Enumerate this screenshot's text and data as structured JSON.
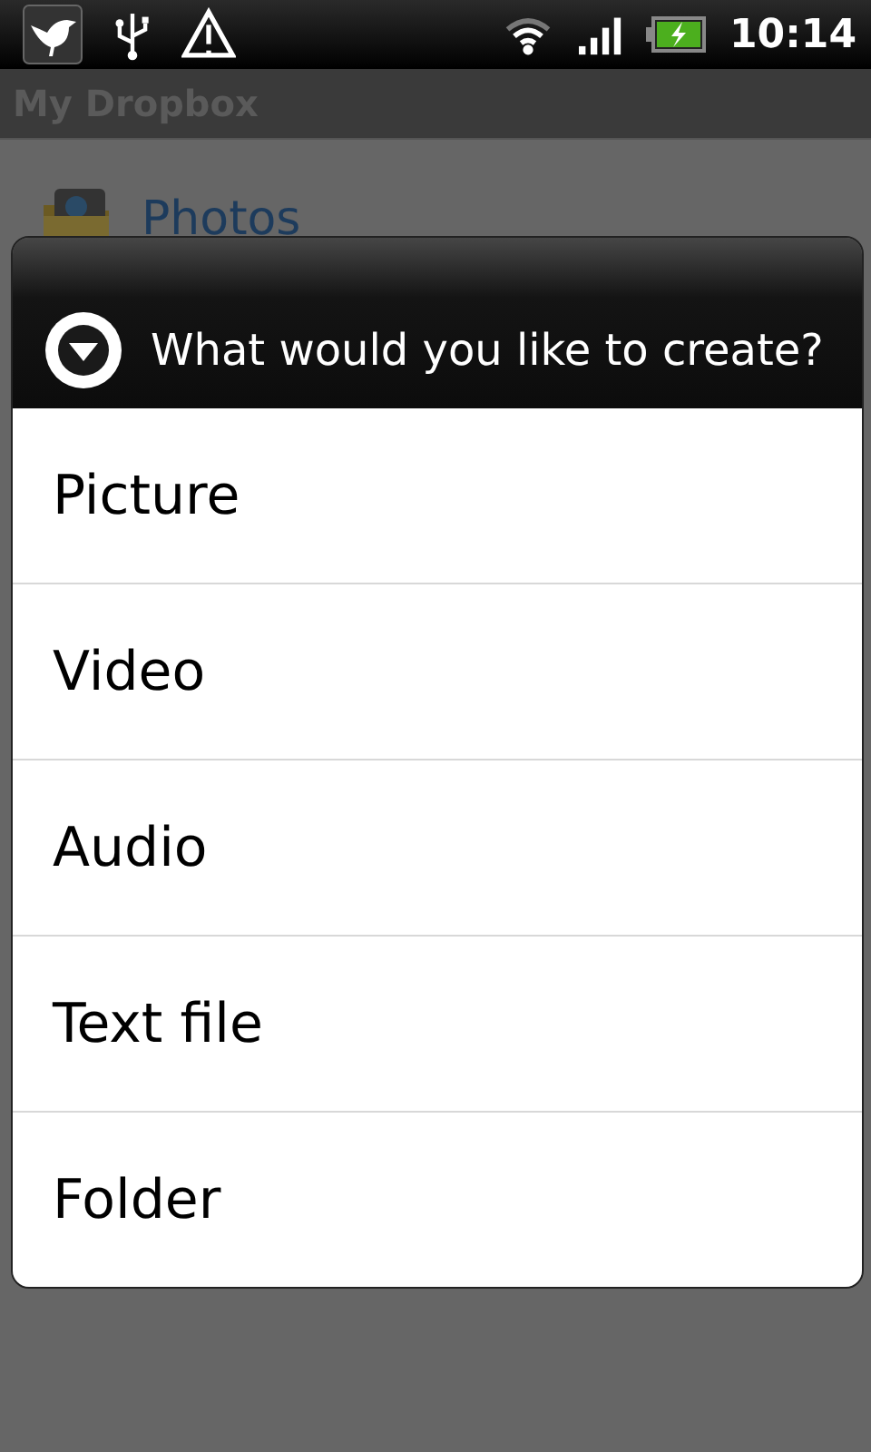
{
  "status_bar": {
    "time": "10:14"
  },
  "app_bar": {
    "title": "My Dropbox"
  },
  "folders": [
    {
      "name": "Photos",
      "kind": "photos"
    }
  ],
  "dialog": {
    "title": "What would you like to create?",
    "options": [
      "Picture",
      "Video",
      "Audio",
      "Text file",
      "Folder"
    ]
  }
}
